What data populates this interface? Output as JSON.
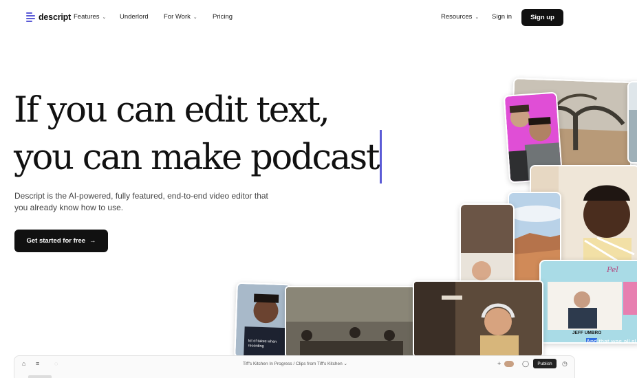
{
  "brand": {
    "name": "descript",
    "accent": "#5b5bd6"
  },
  "nav": {
    "items": [
      {
        "label": "Features",
        "dropdown": true
      },
      {
        "label": "Underlord",
        "dropdown": false
      },
      {
        "label": "For Work",
        "dropdown": true
      },
      {
        "label": "Pricing",
        "dropdown": false
      }
    ],
    "right": {
      "resources": "Resources",
      "signin": "Sign in",
      "signup": "Sign up"
    }
  },
  "hero": {
    "line1": "If you can edit text,",
    "line2": "you can make podcast",
    "subtext": "Descript is the AI-powered, fully featured, end-to-end video editor that you already know how to use.",
    "cta": "Get started for free",
    "cta_arrow": "→"
  },
  "collage": {
    "caption_tile1": "lot of takes when recording",
    "lower_third_name": "JEFF UMBRO",
    "lower_third_caption_highlight": "And",
    "lower_third_caption_rest": " that was all sl",
    "brand_script": "Pel"
  },
  "app": {
    "breadcrumb": "Tiff's Kitchen In Progress  /  Clips from Tiff's Kitchen ⌄",
    "publish": "Publish",
    "icons": [
      "home-icon",
      "menu-icon",
      "add-icon",
      "comment-icon",
      "history-icon"
    ]
  }
}
